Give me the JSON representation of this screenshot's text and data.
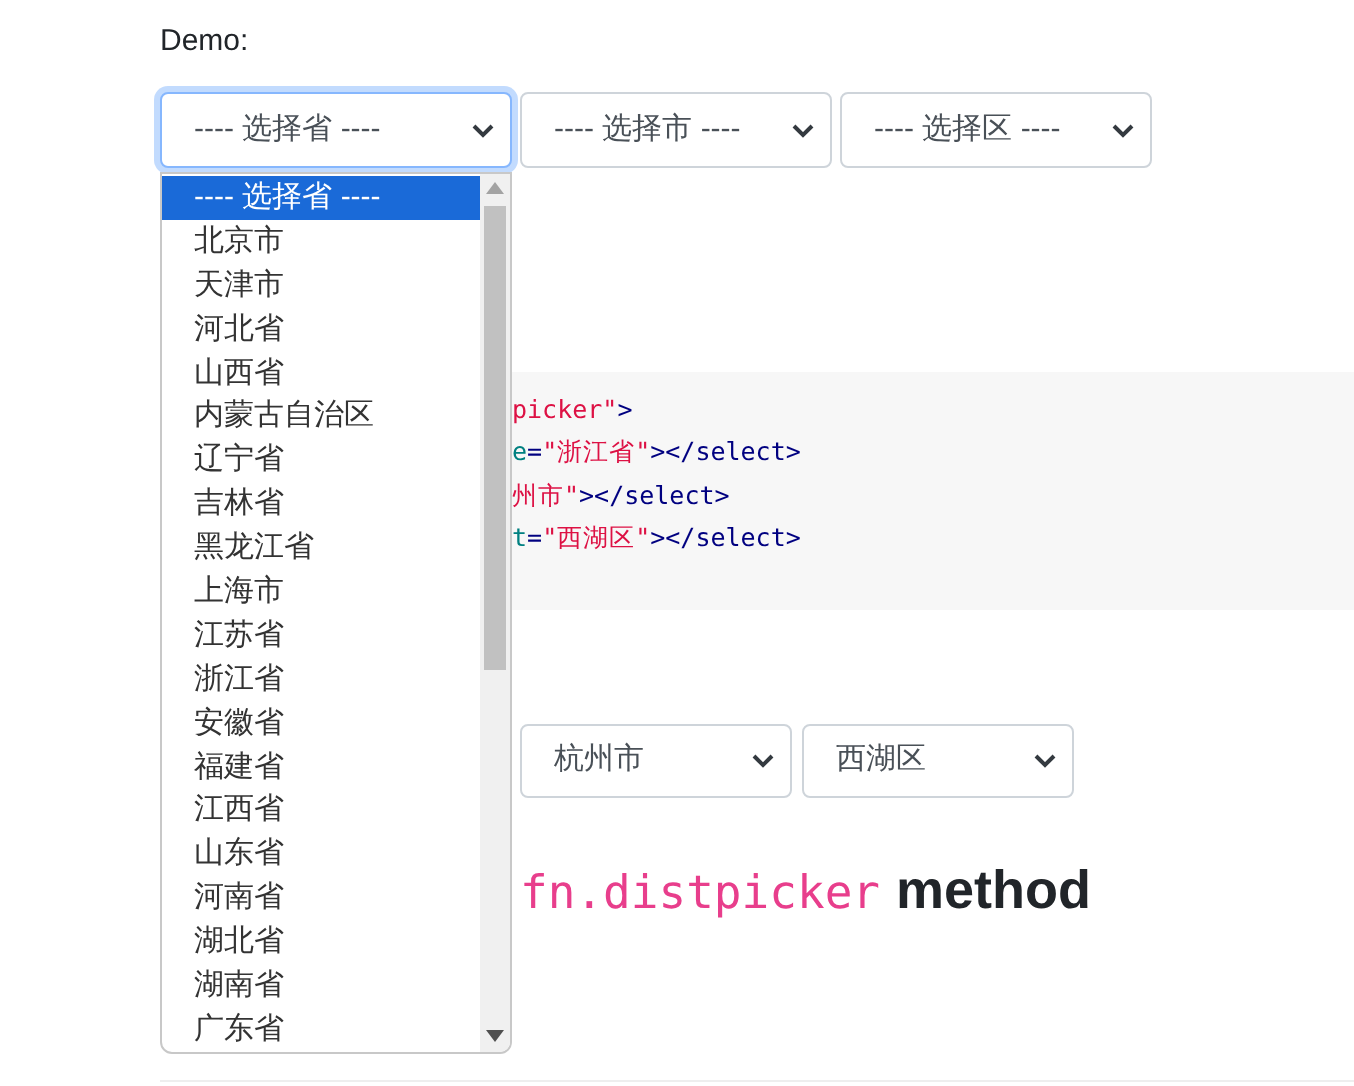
{
  "label": "Demo:",
  "pickers": [
    {
      "value": "---- 选择省 ----",
      "focused": true
    },
    {
      "value": "---- 选择市 ----",
      "focused": false
    },
    {
      "value": "---- 选择区 ----",
      "focused": false
    }
  ],
  "dropdown": {
    "options": [
      {
        "label": "---- 选择省 ----",
        "selected": true
      },
      {
        "label": "北京市",
        "selected": false
      },
      {
        "label": "天津市",
        "selected": false
      },
      {
        "label": "河北省",
        "selected": false
      },
      {
        "label": "山西省",
        "selected": false
      },
      {
        "label": "内蒙古自治区",
        "selected": false
      },
      {
        "label": "辽宁省",
        "selected": false
      },
      {
        "label": "吉林省",
        "selected": false
      },
      {
        "label": "黑龙江省",
        "selected": false
      },
      {
        "label": "上海市",
        "selected": false
      },
      {
        "label": "江苏省",
        "selected": false
      },
      {
        "label": "浙江省",
        "selected": false
      },
      {
        "label": "安徽省",
        "selected": false
      },
      {
        "label": "福建省",
        "selected": false
      },
      {
        "label": "江西省",
        "selected": false
      },
      {
        "label": "山东省",
        "selected": false
      },
      {
        "label": "河南省",
        "selected": false
      },
      {
        "label": "湖北省",
        "selected": false
      },
      {
        "label": "湖南省",
        "selected": false
      },
      {
        "label": "广东省",
        "selected": false
      }
    ]
  },
  "code_lines": [
    [
      {
        "kind": "string",
        "text": "picker\""
      },
      {
        "kind": "tag",
        "text": ">"
      }
    ],
    [
      {
        "kind": "attr",
        "text": "e"
      },
      {
        "kind": "tag",
        "text": "="
      },
      {
        "kind": "string",
        "text": "\"浙江省\""
      },
      {
        "kind": "tag",
        "text": "></select>"
      }
    ],
    [
      {
        "kind": "string",
        "text": "州市\""
      },
      {
        "kind": "tag",
        "text": "></select>"
      }
    ],
    [
      {
        "kind": "attr",
        "text": "t"
      },
      {
        "kind": "tag",
        "text": "="
      },
      {
        "kind": "string",
        "text": "\"西湖区\""
      },
      {
        "kind": "tag",
        "text": "></select>"
      }
    ]
  ],
  "pickers_2": [
    {
      "value": "杭州市",
      "focused": false
    },
    {
      "value": "西湖区",
      "focused": false
    }
  ],
  "heading": {
    "code": "fn.distpicker",
    "text": "method"
  }
}
